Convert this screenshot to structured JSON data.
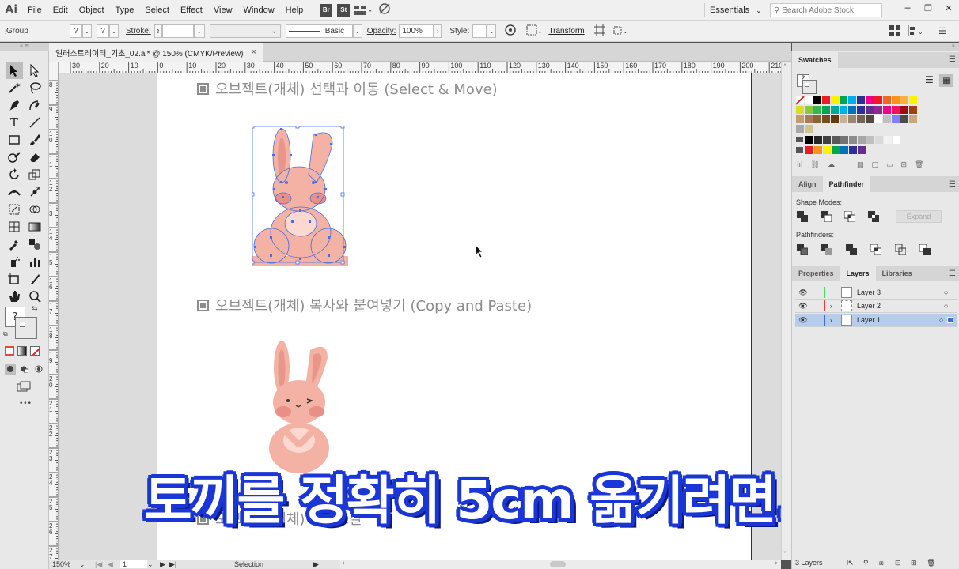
{
  "app": {
    "logo": "Ai"
  },
  "menu": [
    "File",
    "Edit",
    "Object",
    "Type",
    "Select",
    "Effect",
    "View",
    "Window",
    "Help"
  ],
  "bridge": {
    "br": "Br",
    "st": "St"
  },
  "workspace": "Essentials",
  "search": {
    "placeholder": "Search Adobe Stock"
  },
  "control": {
    "selection_type": "Group",
    "q1": "?",
    "q2": "?",
    "stroke_label": "Stroke:",
    "brush": "Basic",
    "opacity_label": "Opacity:",
    "opacity_value": "100%",
    "style_label": "Style:",
    "transform": "Transform"
  },
  "document_tab": {
    "title": "일러스트레이터_기초_02.ai* @ 150% (CMYK/Preview)",
    "close": "×"
  },
  "ruler_h": [
    "30",
    "20",
    "10",
    "0",
    "10",
    "20",
    "30",
    "40",
    "50",
    "60",
    "70",
    "80",
    "90",
    "100",
    "110",
    "120",
    "130",
    "140",
    "150",
    "160",
    "170",
    "180",
    "190",
    "200",
    "210"
  ],
  "ruler_v": [
    "8",
    "9",
    "1 0",
    "1 1",
    "1 2",
    "1 3",
    "1 4",
    "1 5",
    "1 6",
    "1 7",
    "1 8",
    "1 9",
    "2 0",
    "2 1",
    "2 2",
    "2 3",
    "2 4",
    "2 5",
    "2 6",
    "2 7"
  ],
  "artboard": {
    "section1": "오브젝트(개체) 선택과 이동 (Select & Move)",
    "section2": "오브젝트(개체) 복사와 붙여넣기 (Copy and Paste)",
    "section3": "오브젝트(개체) 크기조절"
  },
  "caption": "토끼를 정확히 5cm 옮기려면...?",
  "status": {
    "zoom": "150%",
    "artboard_num": "1",
    "tool": "Selection"
  },
  "panels": {
    "swatches_tab": "Swatches",
    "swatch_q": "?",
    "align_tab": "Align",
    "pathfinder_tab": "Pathfinder",
    "shape_modes": "Shape Modes:",
    "expand": "Expand",
    "pathfinders": "Pathfinders:",
    "properties_tab": "Properties",
    "layers_tab": "Layers",
    "libraries_tab": "Libraries",
    "layers": [
      {
        "name": "Layer 3",
        "color": "#4cd964"
      },
      {
        "name": "Layer 2",
        "color": "#ff3b30"
      },
      {
        "name": "Layer 1",
        "color": "#3c6fd8"
      }
    ],
    "layers_count": "3 Layers"
  },
  "colors": {
    "accent_caption": "#1b36d6",
    "selection": "#4a6ee0",
    "bunny": "#f4b2a4"
  }
}
